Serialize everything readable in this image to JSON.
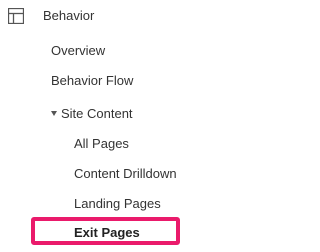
{
  "section": {
    "label": "Behavior",
    "icon": "behavior-layout-icon"
  },
  "items": [
    {
      "label": "Overview"
    },
    {
      "label": "Behavior Flow"
    },
    {
      "label": "Site Content",
      "expanded": true,
      "icon": "caret-down-icon"
    }
  ],
  "site_content_items": [
    {
      "label": "All Pages"
    },
    {
      "label": "Content Drilldown"
    },
    {
      "label": "Landing Pages"
    },
    {
      "label": "Exit Pages",
      "selected": true
    }
  ],
  "colors": {
    "highlight_border": "#ea1a6b",
    "text": "#333333"
  }
}
